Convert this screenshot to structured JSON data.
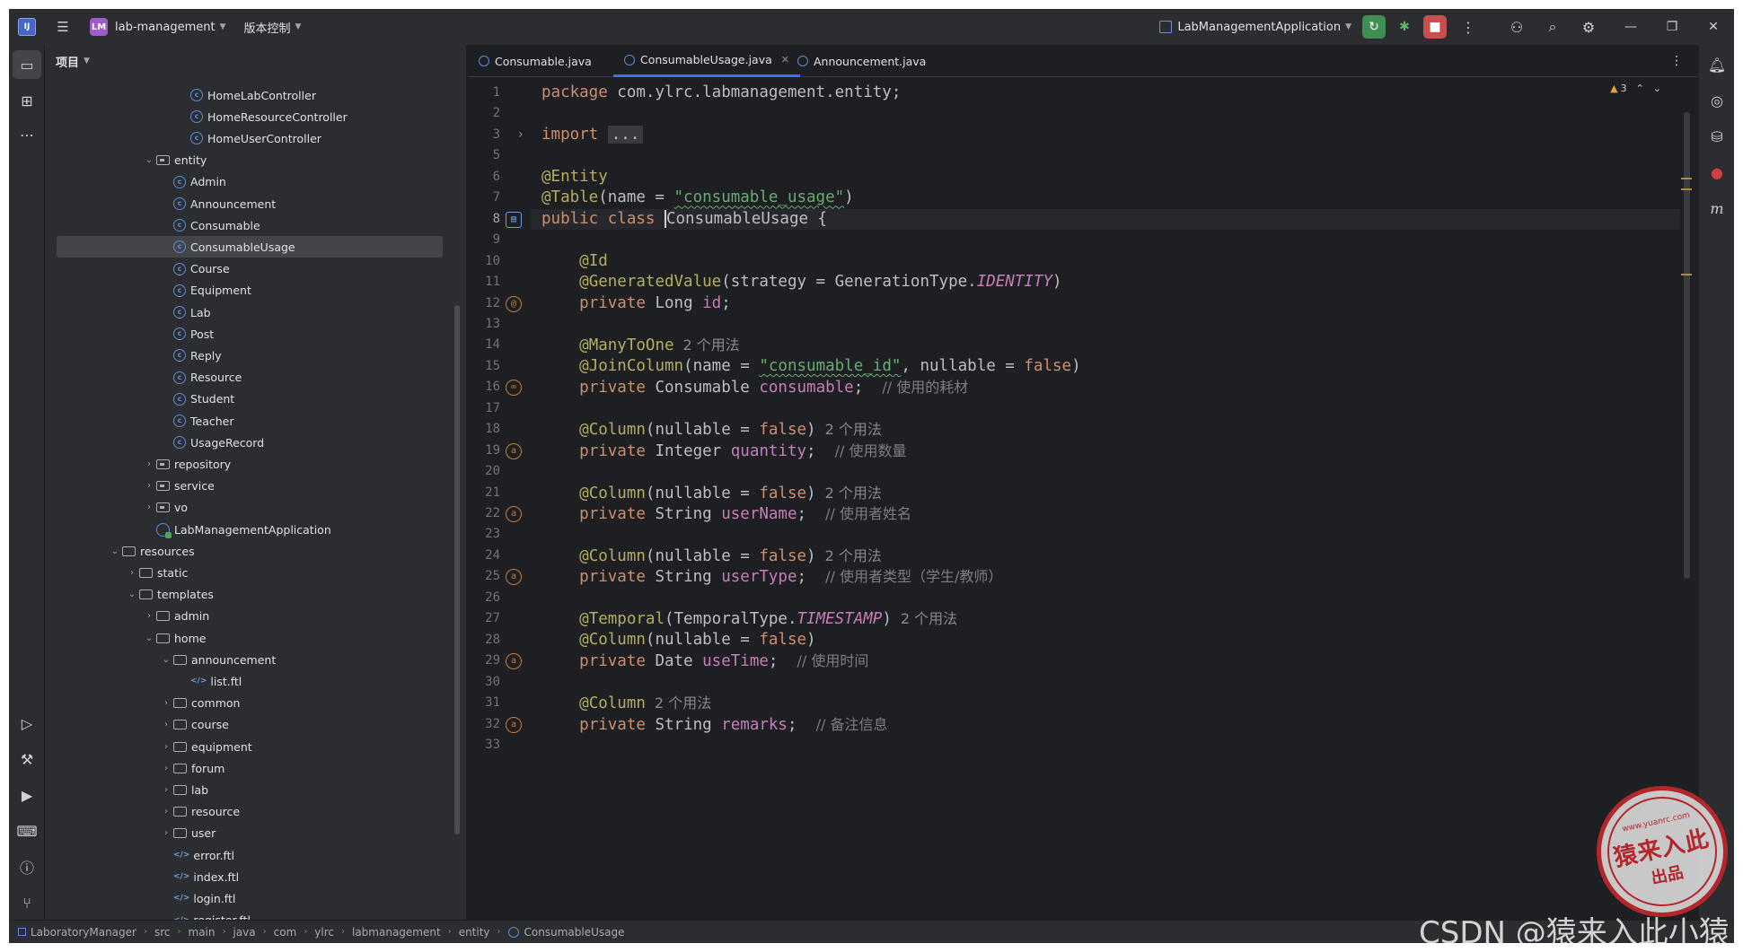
{
  "titlebar": {
    "logo": "IJ",
    "project_badge": "LM",
    "project_name": "lab-management",
    "vcs_menu": "版本控制",
    "run_config": "LabManagementApplication"
  },
  "project_panel": {
    "title": "项目",
    "tree": [
      {
        "label": "HomeLabController",
        "type": "class",
        "indent": 8
      },
      {
        "label": "HomeResourceController",
        "type": "class",
        "indent": 8
      },
      {
        "label": "HomeUserController",
        "type": "class",
        "indent": 8
      },
      {
        "label": "entity",
        "type": "package",
        "indent": 6,
        "arrow": "down"
      },
      {
        "label": "Admin",
        "type": "class",
        "indent": 7
      },
      {
        "label": "Announcement",
        "type": "class",
        "indent": 7
      },
      {
        "label": "Consumable",
        "type": "class",
        "indent": 7
      },
      {
        "label": "ConsumableUsage",
        "type": "class",
        "indent": 7,
        "selected": true
      },
      {
        "label": "Course",
        "type": "class",
        "indent": 7
      },
      {
        "label": "Equipment",
        "type": "class",
        "indent": 7
      },
      {
        "label": "Lab",
        "type": "class",
        "indent": 7
      },
      {
        "label": "Post",
        "type": "class",
        "indent": 7
      },
      {
        "label": "Reply",
        "type": "class",
        "indent": 7
      },
      {
        "label": "Resource",
        "type": "class",
        "indent": 7
      },
      {
        "label": "Student",
        "type": "class",
        "indent": 7
      },
      {
        "label": "Teacher",
        "type": "class",
        "indent": 7
      },
      {
        "label": "UsageRecord",
        "type": "class",
        "indent": 7
      },
      {
        "label": "repository",
        "type": "package",
        "indent": 6,
        "arrow": "right"
      },
      {
        "label": "service",
        "type": "package",
        "indent": 6,
        "arrow": "right"
      },
      {
        "label": "vo",
        "type": "package",
        "indent": 6,
        "arrow": "right"
      },
      {
        "label": "LabManagementApplication",
        "type": "app",
        "indent": 6
      },
      {
        "label": "resources",
        "type": "folder",
        "indent": 4,
        "arrow": "down"
      },
      {
        "label": "static",
        "type": "folder",
        "indent": 5,
        "arrow": "right"
      },
      {
        "label": "templates",
        "type": "folder",
        "indent": 5,
        "arrow": "down"
      },
      {
        "label": "admin",
        "type": "folder",
        "indent": 6,
        "arrow": "right"
      },
      {
        "label": "home",
        "type": "folder",
        "indent": 6,
        "arrow": "down"
      },
      {
        "label": "announcement",
        "type": "folder",
        "indent": 7,
        "arrow": "down"
      },
      {
        "label": "list.ftl",
        "type": "ftl",
        "indent": 8
      },
      {
        "label": "common",
        "type": "folder",
        "indent": 7,
        "arrow": "right"
      },
      {
        "label": "course",
        "type": "folder",
        "indent": 7,
        "arrow": "right"
      },
      {
        "label": "equipment",
        "type": "folder",
        "indent": 7,
        "arrow": "right"
      },
      {
        "label": "forum",
        "type": "folder",
        "indent": 7,
        "arrow": "right"
      },
      {
        "label": "lab",
        "type": "folder",
        "indent": 7,
        "arrow": "right"
      },
      {
        "label": "resource",
        "type": "folder",
        "indent": 7,
        "arrow": "right"
      },
      {
        "label": "user",
        "type": "folder",
        "indent": 7,
        "arrow": "right"
      },
      {
        "label": "error.ftl",
        "type": "ftl",
        "indent": 7
      },
      {
        "label": "index.ftl",
        "type": "ftl",
        "indent": 7
      },
      {
        "label": "login.ftl",
        "type": "ftl",
        "indent": 7
      },
      {
        "label": "register.ftl",
        "type": "ftl",
        "indent": 7
      }
    ]
  },
  "editor": {
    "tabs": [
      {
        "label": "Consumable.java",
        "active": false
      },
      {
        "label": "ConsumableUsage.java",
        "active": true
      },
      {
        "label": "Announcement.java",
        "active": false
      }
    ],
    "warnings_count": "3",
    "current_line": 8,
    "lines": [
      {
        "n": "1",
        "html": "<span class=\"kw\">package</span> com.ylrc.labmanagement.entity;"
      },
      {
        "n": "2",
        "html": ""
      },
      {
        "n": "3",
        "html": "<span class=\"kw\">import</span> <span class=\"fold\">...</span>"
      },
      {
        "n": "5",
        "html": ""
      },
      {
        "n": "6",
        "html": "<span class=\"ann\">@Entity</span>"
      },
      {
        "n": "7",
        "html": "<span class=\"ann\">@Table</span>(name = <span class=\"str\">\"consumable_usage\"</span>)"
      },
      {
        "n": "8",
        "html": "<span class=\"kw\">public class</span> <span class=\"caretline\"></span>ConsumableUsage {"
      },
      {
        "n": "9",
        "html": ""
      },
      {
        "n": "10",
        "html": "    <span class=\"ann\">@Id</span>"
      },
      {
        "n": "11",
        "html": "    <span class=\"ann\">@GeneratedValue</span>(strategy = GenerationType.<span class=\"cst\">IDENTITY</span>)"
      },
      {
        "n": "12",
        "html": "    <span class=\"kw\">private</span> Long <span class=\"fld\">id</span>;"
      },
      {
        "n": "13",
        "html": ""
      },
      {
        "n": "14",
        "html": "    <span class=\"ann\">@ManyToOne</span><span class=\"hint\">2 个用法</span>"
      },
      {
        "n": "15",
        "html": "    <span class=\"ann\">@JoinColumn</span>(name = <span class=\"str\">\"consumable_id\"</span>, nullable = <span class=\"kw\">false</span>)"
      },
      {
        "n": "16",
        "html": "    <span class=\"kw\">private</span> Consumable <span class=\"fld\">consumable</span>;  <span class=\"cmt\">// 使用的耗材</span>"
      },
      {
        "n": "17",
        "html": ""
      },
      {
        "n": "18",
        "html": "    <span class=\"ann\">@Column</span>(nullable = <span class=\"kw\">false</span>)<span class=\"hint\">2 个用法</span>"
      },
      {
        "n": "19",
        "html": "    <span class=\"kw\">private</span> Integer <span class=\"fld\">quantity</span>;  <span class=\"cmt\">// 使用数量</span>"
      },
      {
        "n": "20",
        "html": ""
      },
      {
        "n": "21",
        "html": "    <span class=\"ann\">@Column</span>(nullable = <span class=\"kw\">false</span>)<span class=\"hint\">2 个用法</span>"
      },
      {
        "n": "22",
        "html": "    <span class=\"kw\">private</span> String <span class=\"fld\">userName</span>;  <span class=\"cmt\">// 使用者姓名</span>"
      },
      {
        "n": "23",
        "html": ""
      },
      {
        "n": "24",
        "html": "    <span class=\"ann\">@Column</span>(nullable = <span class=\"kw\">false</span>)<span class=\"hint\">2 个用法</span>"
      },
      {
        "n": "25",
        "html": "    <span class=\"kw\">private</span> String <span class=\"fld\">userType</span>;  <span class=\"cmt\">// 使用者类型（学生/教师）</span>"
      },
      {
        "n": "26",
        "html": ""
      },
      {
        "n": "27",
        "html": "    <span class=\"ann\">@Temporal</span>(TemporalType.<span class=\"cst\">TIMESTAMP</span>)<span class=\"hint\">2 个用法</span>"
      },
      {
        "n": "28",
        "html": "    <span class=\"ann\">@Column</span>(nullable = <span class=\"kw\">false</span>)"
      },
      {
        "n": "29",
        "html": "    <span class=\"kw\">private</span> Date <span class=\"fld\">useTime</span>;  <span class=\"cmt\">// 使用时间</span>"
      },
      {
        "n": "30",
        "html": ""
      },
      {
        "n": "31",
        "html": "    <span class=\"ann\">@Column</span><span class=\"hint\">2 个用法</span>"
      },
      {
        "n": "32",
        "html": "    <span class=\"kw\">private</span> String <span class=\"fld\">remarks</span>;  <span class=\"cmt\">// 备注信息</span>"
      },
      {
        "n": "33",
        "html": ""
      }
    ],
    "gutter_icons": [
      {
        "line": "8",
        "glyph": "▤"
      },
      {
        "line": "12",
        "glyph": "@"
      },
      {
        "line": "16",
        "glyph": "∞"
      },
      {
        "line": "19",
        "glyph": "a"
      },
      {
        "line": "22",
        "glyph": "a"
      },
      {
        "line": "25",
        "glyph": "a"
      },
      {
        "line": "29",
        "glyph": "a"
      },
      {
        "line": "32",
        "glyph": "a"
      }
    ]
  },
  "breadcrumb": [
    "LaboratoryManager",
    "src",
    "main",
    "java",
    "com",
    "ylrc",
    "labmanagement",
    "entity",
    "ConsumableUsage"
  ],
  "watermark": {
    "stamp_url": "www.yuanrc.com",
    "stamp_main": "猿来入此",
    "stamp_sub": "出品",
    "csdn": "CSDN @猿来入此小猿"
  },
  "colors": {
    "accent": "#3574f0",
    "run_green": "#3f8f55",
    "stop_red": "#c94f4f",
    "stamp_red": "#b3262b"
  }
}
